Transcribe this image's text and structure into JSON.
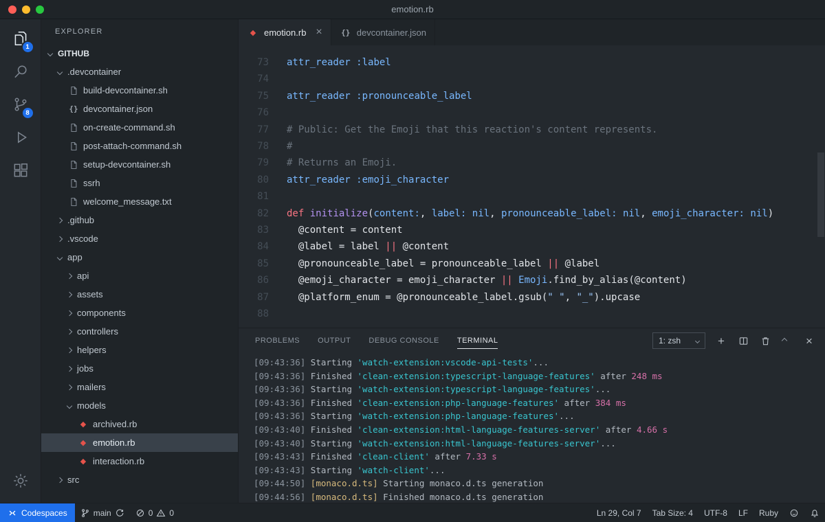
{
  "window": {
    "title": "emotion.rb"
  },
  "activity_bar": {
    "explorer_badge": "1",
    "scm_badge": "8"
  },
  "sidebar": {
    "title": "EXPLORER",
    "tree": [
      {
        "label": "GITHUB",
        "level": 0,
        "type": "root",
        "expanded": true
      },
      {
        "label": ".devcontainer",
        "level": 1,
        "type": "folder",
        "expanded": true
      },
      {
        "label": "build-devcontainer.sh",
        "level": 2,
        "type": "file",
        "icon": "shell"
      },
      {
        "label": "devcontainer.json",
        "level": 2,
        "type": "file",
        "icon": "json"
      },
      {
        "label": "on-create-command.sh",
        "level": 2,
        "type": "file",
        "icon": "shell"
      },
      {
        "label": "post-attach-command.sh",
        "level": 2,
        "type": "file",
        "icon": "shell"
      },
      {
        "label": "setup-devcontainer.sh",
        "level": 2,
        "type": "file",
        "icon": "shell"
      },
      {
        "label": "ssrh",
        "level": 2,
        "type": "file",
        "icon": "shell"
      },
      {
        "label": "welcome_message.txt",
        "level": 2,
        "type": "file",
        "icon": "text"
      },
      {
        "label": ".github",
        "level": 1,
        "type": "folder",
        "expanded": false
      },
      {
        "label": ".vscode",
        "level": 1,
        "type": "folder",
        "expanded": false
      },
      {
        "label": "app",
        "level": 1,
        "type": "folder",
        "expanded": true
      },
      {
        "label": "api",
        "level": 2,
        "type": "folder",
        "expanded": false
      },
      {
        "label": "assets",
        "level": 2,
        "type": "folder",
        "expanded": false
      },
      {
        "label": "components",
        "level": 2,
        "type": "folder",
        "expanded": false
      },
      {
        "label": "controllers",
        "level": 2,
        "type": "folder",
        "expanded": false
      },
      {
        "label": "helpers",
        "level": 2,
        "type": "folder",
        "expanded": false
      },
      {
        "label": "jobs",
        "level": 2,
        "type": "folder",
        "expanded": false
      },
      {
        "label": "mailers",
        "level": 2,
        "type": "folder",
        "expanded": false
      },
      {
        "label": "models",
        "level": 2,
        "type": "folder",
        "expanded": true
      },
      {
        "label": "archived.rb",
        "level": 3,
        "type": "file",
        "icon": "ruby"
      },
      {
        "label": "emotion.rb",
        "level": 3,
        "type": "file",
        "icon": "ruby",
        "selected": true
      },
      {
        "label": "interaction.rb",
        "level": 3,
        "type": "file",
        "icon": "ruby"
      },
      {
        "label": "src",
        "level": 1,
        "type": "folder",
        "expanded": false
      }
    ]
  },
  "editor": {
    "tabs": [
      {
        "label": "emotion.rb",
        "icon": "ruby",
        "active": true,
        "closable": true
      },
      {
        "label": "devcontainer.json",
        "icon": "json",
        "active": false,
        "closable": false
      }
    ],
    "lines": [
      {
        "n": 73,
        "tok": [
          [
            "attr_reader",
            "b"
          ],
          [
            " ",
            "w"
          ],
          [
            ":label",
            "b"
          ]
        ]
      },
      {
        "n": 74,
        "tok": []
      },
      {
        "n": 75,
        "tok": [
          [
            "attr_reader",
            "b"
          ],
          [
            " ",
            "w"
          ],
          [
            ":pronounceable_label",
            "b"
          ]
        ]
      },
      {
        "n": 76,
        "tok": []
      },
      {
        "n": 77,
        "tok": [
          [
            "# Public: Get the Emoji that this reaction's content represents.",
            "c"
          ]
        ]
      },
      {
        "n": 78,
        "tok": [
          [
            "#",
            "c"
          ]
        ]
      },
      {
        "n": 79,
        "tok": [
          [
            "# Returns an Emoji.",
            "c"
          ]
        ]
      },
      {
        "n": 80,
        "tok": [
          [
            "attr_reader",
            "b"
          ],
          [
            " ",
            "w"
          ],
          [
            ":emoji_character",
            "b"
          ]
        ]
      },
      {
        "n": 81,
        "tok": []
      },
      {
        "n": 82,
        "tok": [
          [
            "def",
            "r"
          ],
          [
            " ",
            "w"
          ],
          [
            "initialize",
            "p"
          ],
          [
            "(",
            "w"
          ],
          [
            "content:",
            "b"
          ],
          [
            ", ",
            "w"
          ],
          [
            "label:",
            "b"
          ],
          [
            " ",
            "w"
          ],
          [
            "nil",
            "b"
          ],
          [
            ", ",
            "w"
          ],
          [
            "pronounceable_label:",
            "b"
          ],
          [
            " ",
            "w"
          ],
          [
            "nil",
            "b"
          ],
          [
            ", ",
            "w"
          ],
          [
            "emoji_character:",
            "b"
          ],
          [
            " ",
            "w"
          ],
          [
            "nil",
            "b"
          ],
          [
            ")",
            "w"
          ]
        ]
      },
      {
        "n": 83,
        "tok": [
          [
            "  @content = content",
            "w"
          ]
        ]
      },
      {
        "n": 84,
        "tok": [
          [
            "  @label = label ",
            "w"
          ],
          [
            "||",
            "r"
          ],
          [
            " @content",
            "w"
          ]
        ]
      },
      {
        "n": 85,
        "tok": [
          [
            "  @pronounceable_label = pronounceable_label ",
            "w"
          ],
          [
            "||",
            "r"
          ],
          [
            " @label",
            "w"
          ]
        ]
      },
      {
        "n": 86,
        "tok": [
          [
            "  @emoji_character = emoji_character ",
            "w"
          ],
          [
            "||",
            "r"
          ],
          [
            " ",
            "w"
          ],
          [
            "Emoji",
            "b"
          ],
          [
            ".find_by_alias(@content)",
            "w"
          ]
        ]
      },
      {
        "n": 87,
        "tok": [
          [
            "  @platform_enum = @pronounceable_label.gsub(",
            "w"
          ],
          [
            "\" \"",
            "lb"
          ],
          [
            ", ",
            "w"
          ],
          [
            "\"_\"",
            "lb"
          ],
          [
            ").upcase",
            "w"
          ]
        ]
      },
      {
        "n": 88,
        "tok": []
      }
    ]
  },
  "panel": {
    "tabs": [
      {
        "label": "PROBLEMS",
        "active": false
      },
      {
        "label": "OUTPUT",
        "active": false
      },
      {
        "label": "DEBUG CONSOLE",
        "active": false
      },
      {
        "label": "TERMINAL",
        "active": true
      }
    ],
    "shell": "1: zsh"
  },
  "terminal": {
    "lines": [
      {
        "tok": [
          [
            "[09:43:36] ",
            "g"
          ],
          [
            "Starting ",
            "t"
          ],
          [
            "'watch-extension:vscode-api-tests'",
            "cy"
          ],
          [
            "...",
            "t"
          ]
        ]
      },
      {
        "tok": [
          [
            "[09:43:36] ",
            "g"
          ],
          [
            "Finished ",
            "t"
          ],
          [
            "'clean-extension:typescript-language-features'",
            "cy"
          ],
          [
            " after ",
            "t"
          ],
          [
            "248 ms",
            "m"
          ]
        ]
      },
      {
        "tok": [
          [
            "[09:43:36] ",
            "g"
          ],
          [
            "Starting ",
            "t"
          ],
          [
            "'watch-extension:typescript-language-features'",
            "cy"
          ],
          [
            "...",
            "t"
          ]
        ]
      },
      {
        "tok": [
          [
            "[09:43:36] ",
            "g"
          ],
          [
            "Finished ",
            "t"
          ],
          [
            "'clean-extension:php-language-features'",
            "cy"
          ],
          [
            " after ",
            "t"
          ],
          [
            "384 ms",
            "m"
          ]
        ]
      },
      {
        "tok": [
          [
            "[09:43:36] ",
            "g"
          ],
          [
            "Starting ",
            "t"
          ],
          [
            "'watch-extension:php-language-features'",
            "cy"
          ],
          [
            "...",
            "t"
          ]
        ]
      },
      {
        "tok": [
          [
            "[09:43:40] ",
            "g"
          ],
          [
            "Finished ",
            "t"
          ],
          [
            "'clean-extension:html-language-features-server'",
            "cy"
          ],
          [
            " after ",
            "t"
          ],
          [
            "4.66 s",
            "m"
          ]
        ]
      },
      {
        "tok": [
          [
            "[09:43:40] ",
            "g"
          ],
          [
            "Starting ",
            "t"
          ],
          [
            "'watch-extension:html-language-features-server'",
            "cy"
          ],
          [
            "...",
            "t"
          ]
        ]
      },
      {
        "tok": [
          [
            "[09:43:43] ",
            "g"
          ],
          [
            "Finished ",
            "t"
          ],
          [
            "'clean-client'",
            "cy"
          ],
          [
            " after ",
            "t"
          ],
          [
            "7.33 s",
            "m"
          ]
        ]
      },
      {
        "tok": [
          [
            "[09:43:43] ",
            "g"
          ],
          [
            "Starting ",
            "t"
          ],
          [
            "'watch-client'",
            "cy"
          ],
          [
            "...",
            "t"
          ]
        ]
      },
      {
        "tok": [
          [
            "[09:44:50] ",
            "g"
          ],
          [
            "[monaco.d.ts] ",
            "y"
          ],
          [
            "Starting monaco.d.ts generation",
            "t"
          ]
        ]
      },
      {
        "tok": [
          [
            "[09:44:56] ",
            "g"
          ],
          [
            "[monaco.d.ts] ",
            "y"
          ],
          [
            "Finished monaco.d.ts generation",
            "t"
          ]
        ]
      }
    ]
  },
  "status_bar": {
    "codespaces_label": "Codespaces",
    "branch": "main",
    "errors": "0",
    "warnings": "0",
    "line_col": "Ln 29, Col 7",
    "tab_size": "Tab Size: 4",
    "encoding": "UTF-8",
    "eol": "LF",
    "language": "Ruby"
  },
  "icons": {
    "plus": "+",
    "close": "×",
    "ruby_gem": "◆",
    "json_braces": "{}"
  },
  "colors": {
    "accent_blue": "#1f6feb",
    "ruby_red": "#e5534b",
    "terminal_cyan": "#39c5cf",
    "terminal_magenta": "#d670a8",
    "terminal_yellow": "#d7ba7d"
  }
}
